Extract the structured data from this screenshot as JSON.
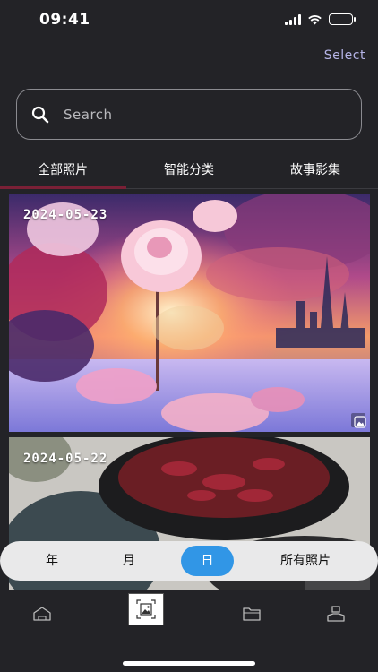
{
  "status_bar": {
    "time": "09:41"
  },
  "header": {
    "select_label": "Select"
  },
  "search": {
    "placeholder": "Search",
    "icon": "search-icon"
  },
  "tabs": [
    {
      "label": "全部照片",
      "active": true
    },
    {
      "label": "智能分类",
      "active": false
    },
    {
      "label": "故事影集",
      "active": false
    }
  ],
  "photos": [
    {
      "date": "2024-05-23",
      "badge_icon": "gallery-icon"
    },
    {
      "date": "2024-05-22"
    }
  ],
  "view_modes": [
    {
      "label": "年",
      "active": false
    },
    {
      "label": "月",
      "active": false
    },
    {
      "label": "日",
      "active": true
    },
    {
      "label": "所有照片",
      "active": false
    }
  ],
  "bottom_nav": [
    {
      "icon": "home-icon",
      "active": false
    },
    {
      "icon": "photos-icon",
      "active": true
    },
    {
      "icon": "folder-icon",
      "active": false
    },
    {
      "icon": "profile-icon",
      "active": false
    }
  ],
  "colors": {
    "background": "#232327",
    "accent": "#3196e6",
    "tab_underline": "#7a2036",
    "select_text": "#b6b5e8"
  }
}
